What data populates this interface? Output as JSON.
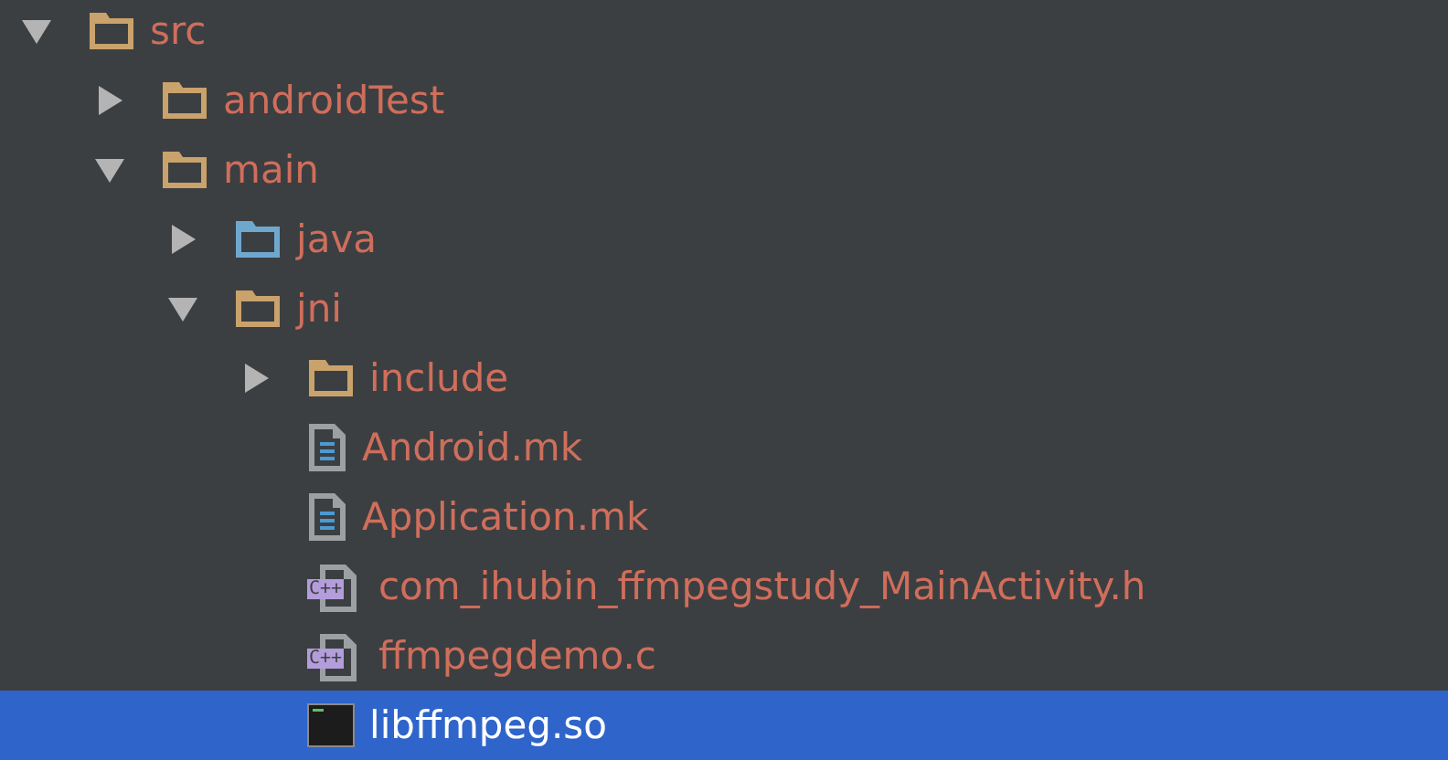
{
  "tree": [
    {
      "label": "src",
      "kind": "folder",
      "expanded": true,
      "selected": false,
      "children": [
        {
          "label": "androidTest",
          "kind": "folder",
          "expanded": false,
          "selected": false
        },
        {
          "label": "main",
          "kind": "folder",
          "expanded": true,
          "selected": false,
          "children": [
            {
              "label": "java",
              "kind": "source-folder",
              "expanded": false,
              "selected": false
            },
            {
              "label": "jni",
              "kind": "folder",
              "expanded": true,
              "selected": false,
              "children": [
                {
                  "label": "include",
                  "kind": "folder",
                  "expanded": false,
                  "selected": false
                },
                {
                  "label": "Android.mk",
                  "kind": "text-file",
                  "selected": false
                },
                {
                  "label": "Application.mk",
                  "kind": "text-file",
                  "selected": false
                },
                {
                  "label": "com_ihubin_ffmpegstudy_MainActivity.h",
                  "kind": "cpp-file",
                  "badge": "C++",
                  "selected": false
                },
                {
                  "label": "ffmpegdemo.c",
                  "kind": "cpp-file",
                  "badge": "C++",
                  "selected": false
                },
                {
                  "label": "libffmpeg.so",
                  "kind": "binary-file",
                  "selected": true
                }
              ]
            }
          ]
        }
      ]
    }
  ]
}
